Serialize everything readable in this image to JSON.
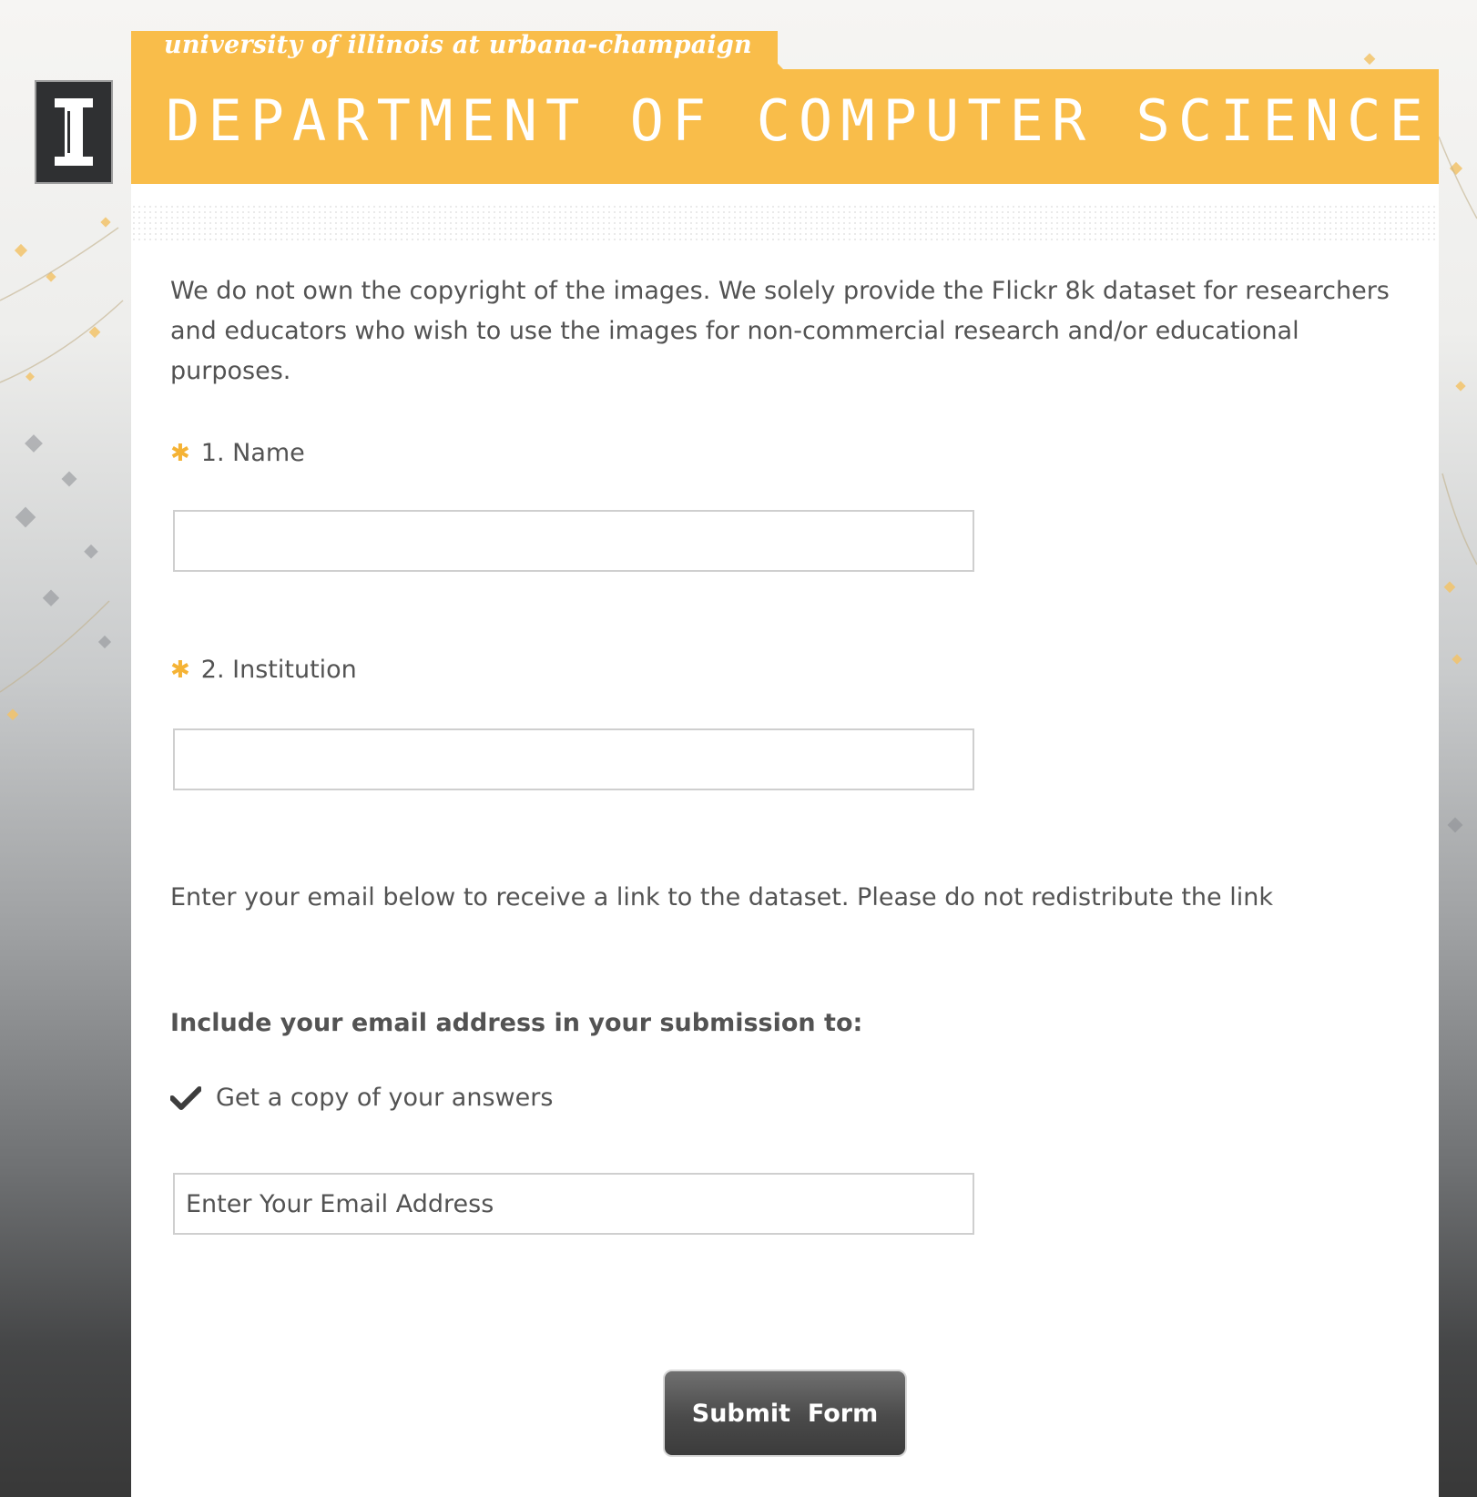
{
  "header": {
    "university": "university of illinois at urbana-champaign",
    "department": "DEPARTMENT OF COMPUTER SCIENCE",
    "logo_icon": "illinois-block-i-icon"
  },
  "colors": {
    "accent": "#f9bd4a",
    "text": "#535353",
    "button": "#4a4a4a"
  },
  "form": {
    "intro": "We do not own the copyright of the images. We solely provide the Flickr 8k dataset for researchers and educators who wish to use the images for non-commercial research and/or educational purposes.",
    "required_marker": "✱",
    "questions": [
      {
        "label": "1. Name",
        "value": ""
      },
      {
        "label": "2. Institution",
        "value": ""
      }
    ],
    "email_note": "Enter your email below to receive a link to the dataset. Please do not redistribute the link",
    "email_heading": "Include your email address in your submission to:",
    "copy_option": {
      "label": "Get a copy of your answers",
      "checked": true,
      "icon": "check-icon"
    },
    "email_field": {
      "placeholder": "Enter Your Email Address",
      "value": ""
    },
    "submit_label": "Submit  Form"
  }
}
